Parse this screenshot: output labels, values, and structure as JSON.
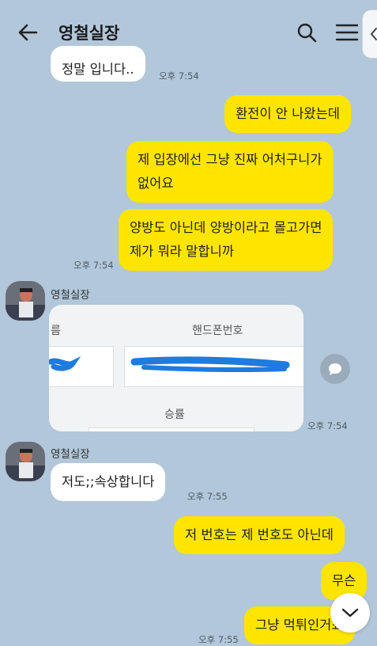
{
  "header": {
    "title": "영철실장",
    "back_icon": "arrow-left-icon",
    "search_icon": "search-icon",
    "menu_icon": "hamburger-menu-icon",
    "side_tab_icon": "chevron-left-icon"
  },
  "messages": [
    {
      "from": "theirs",
      "text": "정말 입니다..",
      "time": "오후 7:54"
    },
    {
      "from": "mine",
      "text": "환전이 안 나왔는데"
    },
    {
      "from": "mine",
      "lines": [
        "제 입장에선 그냥 진짜 어처구니가",
        "없어요"
      ]
    },
    {
      "from": "mine",
      "lines": [
        "양방도 아닌데 양방이라고 몰고가면",
        "제가 뭐라 말합니까"
      ],
      "time": "오후 7:54"
    },
    {
      "from": "theirs",
      "sender": "영철실장",
      "type": "image",
      "time": "오후 7:54"
    },
    {
      "from": "theirs",
      "sender": "영철실장",
      "text": "저도;;속상합니다",
      "time": "오후 7:55"
    },
    {
      "from": "mine",
      "text": "저 번호는 제 번호도 아닌데"
    },
    {
      "from": "mine",
      "text": "무슨"
    },
    {
      "from": "mine",
      "text": "그냥 먹튀인거죠",
      "time": "오후 7:55"
    }
  ],
  "image_card": {
    "col_left": "름",
    "col_right": "핸드폰번호",
    "bottom_label": "승률"
  },
  "buttons": {
    "share_icon": "share-chat-icon",
    "scroll_down_icon": "chevron-down-icon"
  },
  "colors": {
    "background": "#b2c7d9",
    "my_bubble": "#fee500",
    "their_bubble": "#ffffff",
    "redaction": "#1e7be0"
  }
}
